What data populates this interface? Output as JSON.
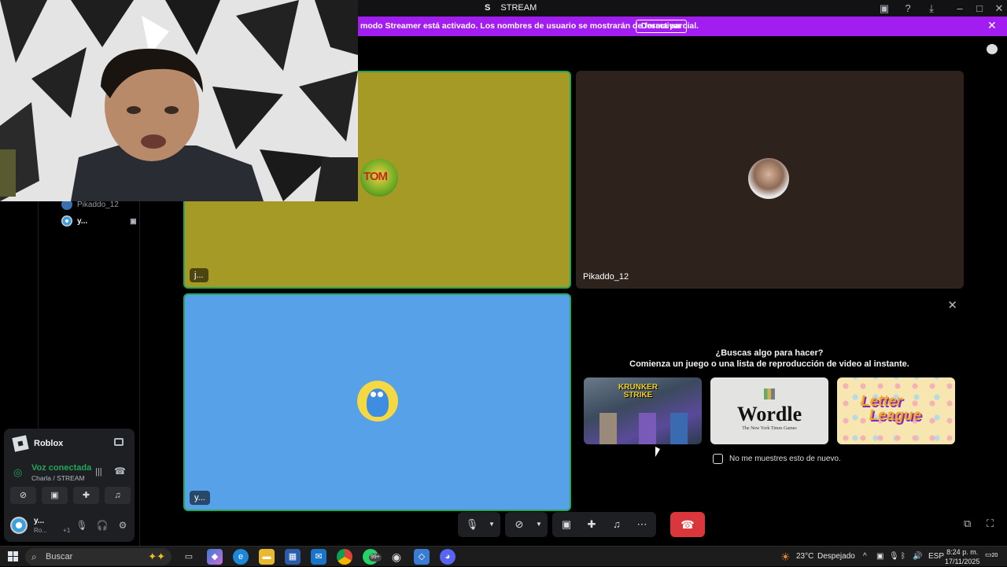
{
  "window": {
    "server_initial": "S",
    "channel_title": "STREAM"
  },
  "banner": {
    "text": "modo Streamer está activado. Los nombres de usuario se mostrarán de forma parcial.",
    "button": "Desactivar"
  },
  "voice_users": [
    {
      "name": "Pikaddo_12"
    },
    {
      "name": "y..."
    }
  ],
  "activity_panel": {
    "game": "Roblox",
    "status": "Voz conectada",
    "channel": "Charla / STREAM",
    "user_name": "y...",
    "user_status": "Ro...",
    "user_extra": "+1"
  },
  "tiles": [
    {
      "label": "j...",
      "avatar_text": "TOM"
    },
    {
      "label": "Pikaddo_12"
    },
    {
      "label": "y..."
    }
  ],
  "suggestion": {
    "question": "¿Buscas algo para hacer?",
    "subtitle": "Comienza un juego o una lista de reproducción de video al instante.",
    "games": [
      {
        "title_line1": "KRUNKER",
        "title_line2": "STRIKE"
      },
      {
        "title": "Wordle",
        "subtitle": "The New York Times Games"
      },
      {
        "title_line1": "Letter",
        "title_line2": "League"
      }
    ],
    "checkbox_label": "No me muestres esto de nuevo."
  },
  "taskbar": {
    "search_placeholder": "Buscar",
    "whatsapp_badge": "99+",
    "weather": "23°C",
    "weather_desc": "Despejado",
    "language": "ESP",
    "time": "8:24 p. m.",
    "date": "17/11/2025",
    "notifications": "20"
  },
  "colors": {
    "banner": "#a21ef0",
    "hangup": "#da373c",
    "connected": "#23a55a",
    "tile_yellow": "#a69a26",
    "tile_blue": "#57a1e8"
  }
}
